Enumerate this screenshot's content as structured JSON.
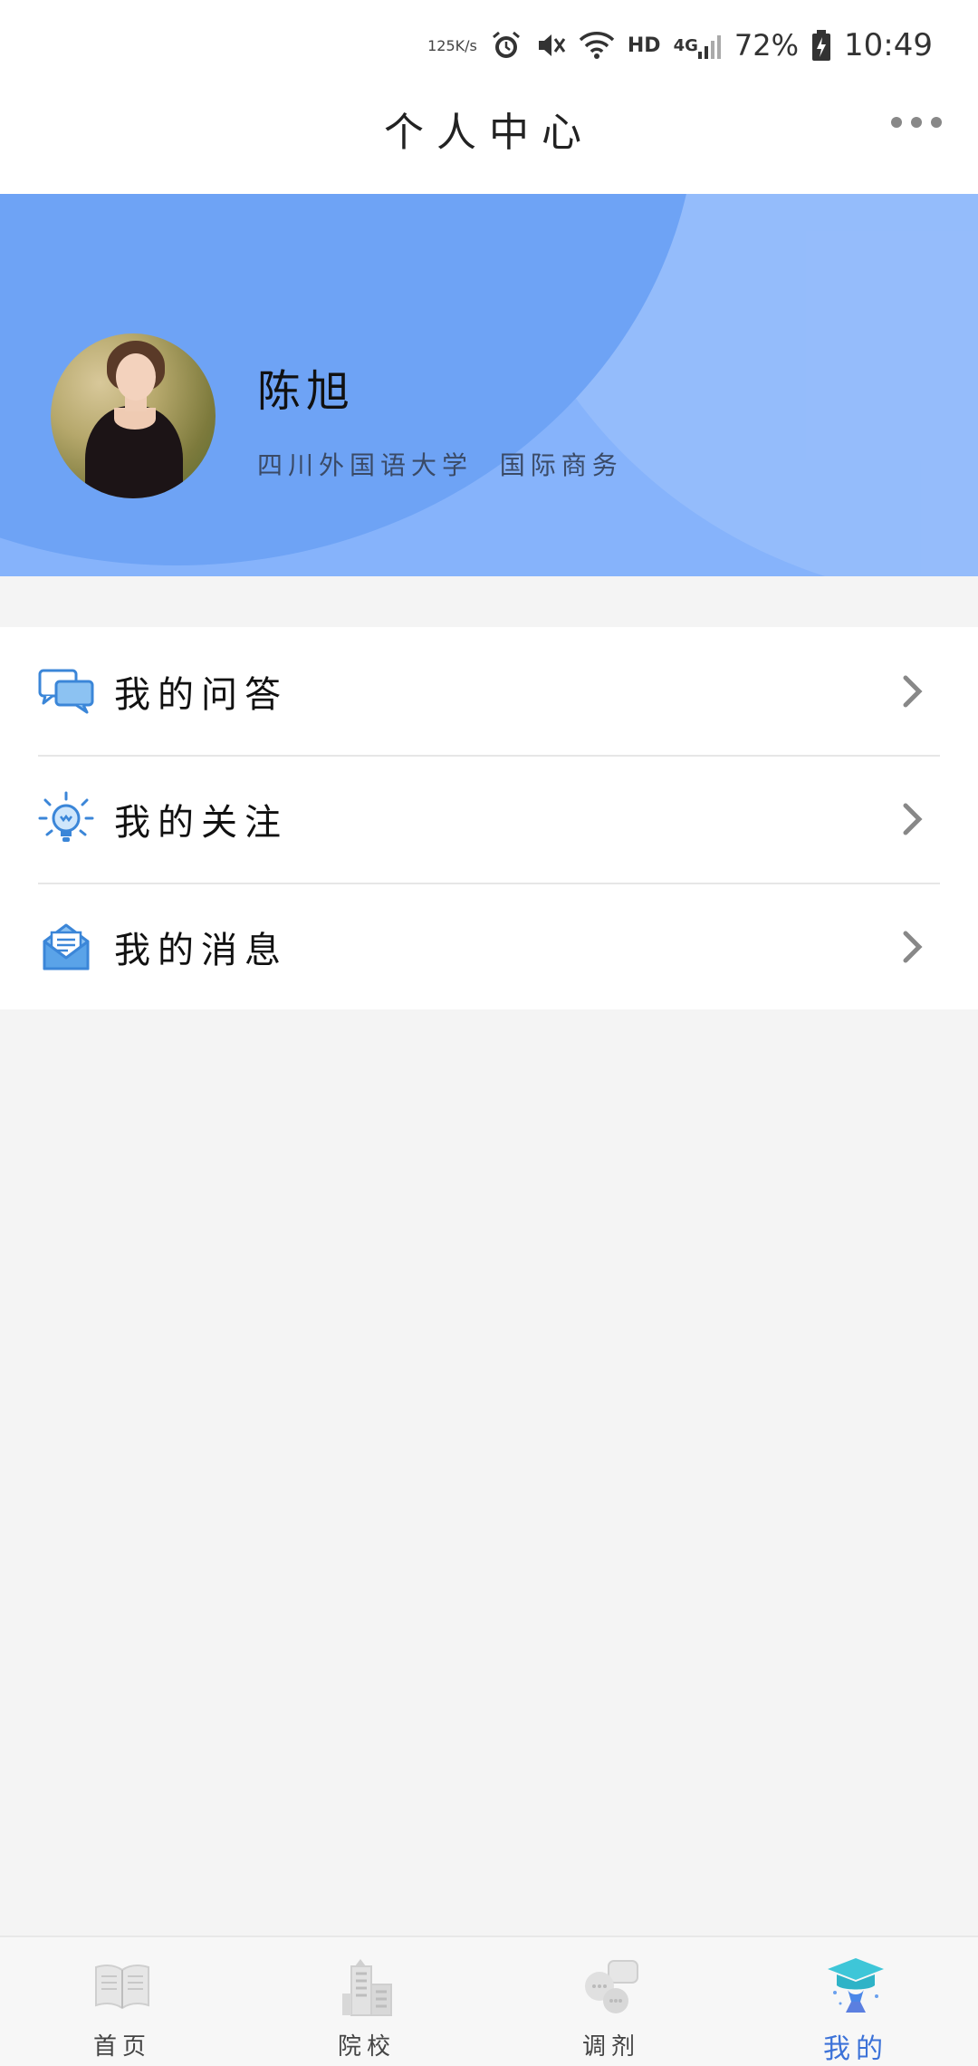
{
  "status_bar": {
    "net_speed_value": "125",
    "net_speed_unit": "K/s",
    "hd": "HD",
    "network": "4G",
    "battery": "72%",
    "time": "10:49"
  },
  "header": {
    "title": "个人中心",
    "more_icon": "more-icon"
  },
  "profile": {
    "name": "陈旭",
    "school": "四川外国语大学  国际商务",
    "colors": {
      "banner": "#86b3fb",
      "banner_dark": "#6ea3f5"
    }
  },
  "menu": {
    "items": [
      {
        "label": "我的问答",
        "icon": "chat-bubbles-icon"
      },
      {
        "label": "我的关注",
        "icon": "lightbulb-icon"
      },
      {
        "label": "我的消息",
        "icon": "mail-icon"
      }
    ]
  },
  "bottom_nav": {
    "items": [
      {
        "label": "首页",
        "icon": "book-icon",
        "active": false
      },
      {
        "label": "院校",
        "icon": "building-icon",
        "active": false
      },
      {
        "label": "调剂",
        "icon": "chat-icon",
        "active": false
      },
      {
        "label": "我的",
        "icon": "graduation-cap-icon",
        "active": true
      }
    ],
    "active_color": "#3c72d8"
  }
}
